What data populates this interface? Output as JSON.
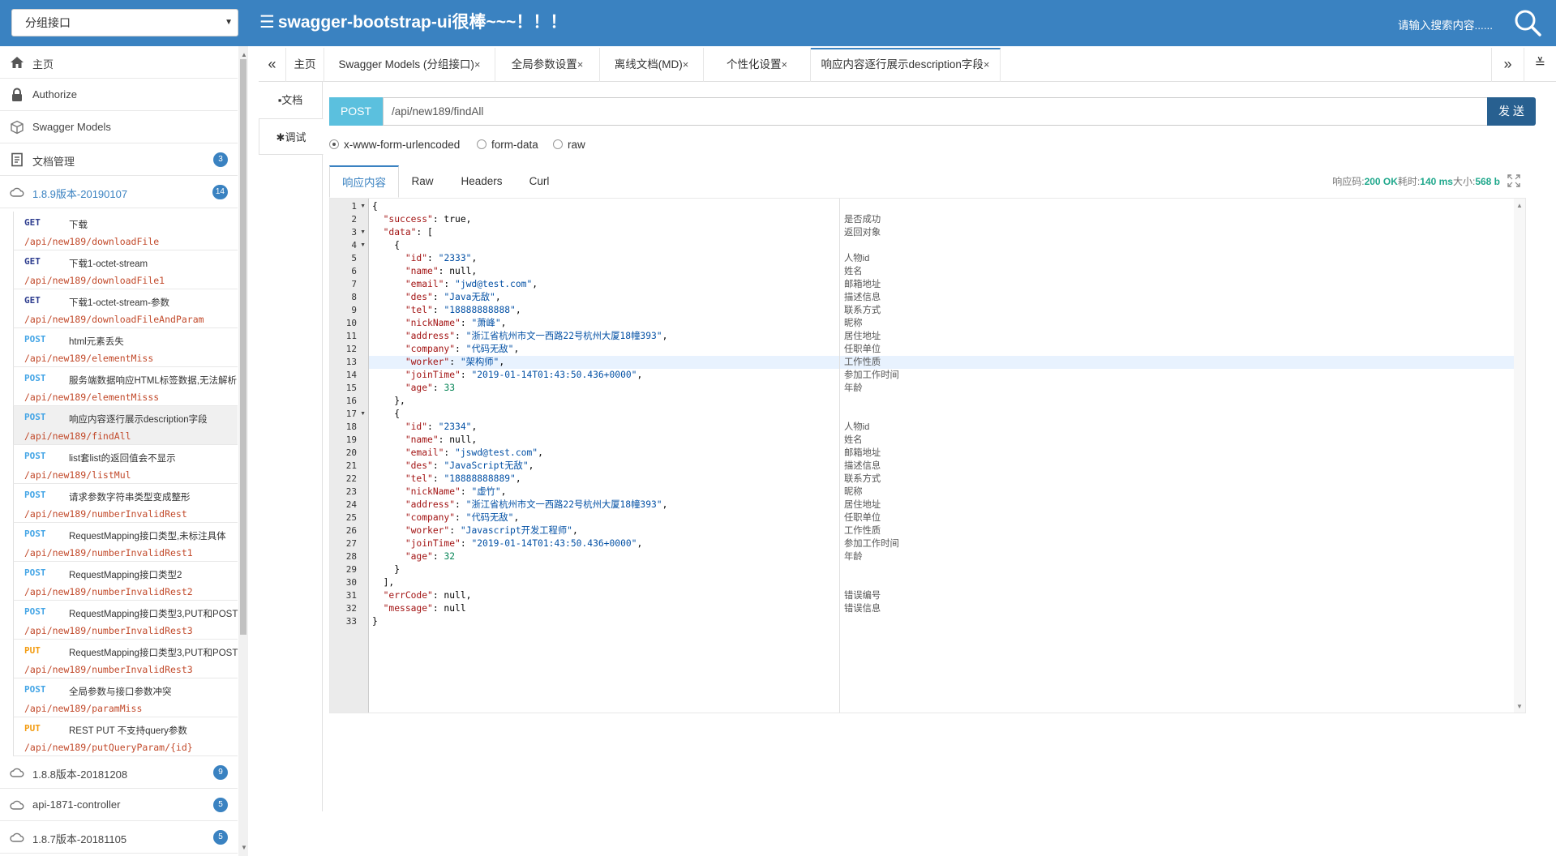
{
  "header": {
    "group_select": "分组接口",
    "menu_glyph": "☰",
    "title": "swagger-bootstrap-ui很棒~~~！！！",
    "search_placeholder": "请输入搜索内容......"
  },
  "sidebar": {
    "items": [
      {
        "label": "主页",
        "icon": "home-icon"
      },
      {
        "label": "Authorize",
        "icon": "lock-icon"
      },
      {
        "label": "Swagger Models",
        "icon": "cube-icon"
      },
      {
        "label": "文档管理",
        "icon": "document-icon",
        "badge": "3"
      },
      {
        "label": "1.8.9版本-20190107",
        "icon": "cloud-icon",
        "badge": "14"
      }
    ],
    "apis": [
      {
        "method": "GET",
        "summary": "下载",
        "path": "/api/new189/downloadFile"
      },
      {
        "method": "GET",
        "summary": "下载1-octet-stream",
        "path": "/api/new189/downloadFile1"
      },
      {
        "method": "GET",
        "summary": "下载1-octet-stream-参数",
        "path": "/api/new189/downloadFileAndParam"
      },
      {
        "method": "POST",
        "summary": "html元素丢失",
        "path": "/api/new189/elementMiss"
      },
      {
        "method": "POST",
        "summary": "服务端数据响应HTML标签数据,无法解析",
        "path": "/api/new189/elementMisss"
      },
      {
        "method": "POST",
        "summary": "响应内容逐行展示description字段",
        "path": "/api/new189/findAll"
      },
      {
        "method": "POST",
        "summary": "list套list的返回值会不显示",
        "path": "/api/new189/listMul"
      },
      {
        "method": "POST",
        "summary": "请求参数字符串类型变成整形",
        "path": "/api/new189/numberInvalidRest"
      },
      {
        "method": "POST",
        "summary": "RequestMapping接口类型,未标注具体",
        "path": "/api/new189/numberInvalidRest1"
      },
      {
        "method": "POST",
        "summary": "RequestMapping接口类型2",
        "path": "/api/new189/numberInvalidRest2"
      },
      {
        "method": "POST",
        "summary": "RequestMapping接口类型3,PUT和POST",
        "path": "/api/new189/numberInvalidRest3"
      },
      {
        "method": "PUT",
        "summary": "RequestMapping接口类型3,PUT和POST",
        "path": "/api/new189/numberInvalidRest3"
      },
      {
        "method": "POST",
        "summary": "全局参数与接口参数冲突",
        "path": "/api/new189/paramMiss"
      },
      {
        "method": "PUT",
        "summary": "REST PUT 不支持query参数",
        "path": "/api/new189/putQueryParam/{id}"
      }
    ],
    "active_api_index": 5,
    "groups": [
      {
        "label": "1.8.8版本-20181208",
        "badge": "9"
      },
      {
        "label": "api-1871-controller",
        "badge": "5"
      },
      {
        "label": "1.8.7版本-20181105",
        "badge": "5"
      }
    ]
  },
  "tabs": {
    "items": [
      {
        "label": "主页",
        "closable": false
      },
      {
        "label": "Swagger Models (分组接口)",
        "closable": true
      },
      {
        "label": "全局参数设置",
        "closable": true
      },
      {
        "label": "离线文档(MD)",
        "closable": true
      },
      {
        "label": "个性化设置",
        "closable": true
      },
      {
        "label": "响应内容逐行展示description字段",
        "closable": true
      }
    ],
    "close_glyph": "×",
    "prev_glyph": "«",
    "next_glyph": "»",
    "menu_glyph": "≚"
  },
  "side_tabs": [
    {
      "label": "文档",
      "glyph": "▪"
    },
    {
      "label": "调试",
      "glyph": "✱"
    }
  ],
  "request": {
    "method": "POST",
    "url": "/api/new189/findAll",
    "send_label": "发 送",
    "content_types": [
      "x-www-form-urlencoded",
      "form-data",
      "raw"
    ],
    "selected_content_type": 0
  },
  "response": {
    "tabs": [
      "响应内容",
      "Raw",
      "Headers",
      "Curl"
    ],
    "status_label": "响应码:",
    "status_value": "200 OK",
    "time_label": "耗时:",
    "time_value": "140 ms",
    "size_label": "大小:",
    "size_value": "568 b",
    "lines": [
      "{",
      "  \"success\": true,",
      "  \"data\": [",
      "    {",
      "      \"id\": \"2333\",",
      "      \"name\": null,",
      "      \"email\": \"jwd@test.com\",",
      "      \"des\": \"Java无敌\",",
      "      \"tel\": \"18888888888\",",
      "      \"nickName\": \"萧峰\",",
      "      \"address\": \"浙江省杭州市文一西路22号杭州大厦18幢393\",",
      "      \"company\": \"代码无敌\",",
      "      \"worker\": \"架构师\",",
      "      \"joinTime\": \"2019-01-14T01:43:50.436+0000\",",
      "      \"age\": 33",
      "    },",
      "    {",
      "      \"id\": \"2334\",",
      "      \"name\": null,",
      "      \"email\": \"jswd@test.com\",",
      "      \"des\": \"JavaScript无敌\",",
      "      \"tel\": \"18888888889\",",
      "      \"nickName\": \"虚竹\",",
      "      \"address\": \"浙江省杭州市文一西路22号杭州大厦18幢393\",",
      "      \"company\": \"代码无敌\",",
      "      \"worker\": \"Javascript开发工程师\",",
      "      \"joinTime\": \"2019-01-14T01:43:50.436+0000\",",
      "      \"age\": 32",
      "    }",
      "  ],",
      "  \"errCode\": null,",
      "  \"message\": null",
      "}"
    ],
    "descriptions": [
      "",
      "是否成功",
      "返回对象",
      "",
      "人物id",
      "姓名",
      "邮箱地址",
      "描述信息",
      "联系方式",
      "昵称",
      "居住地址",
      "任职单位",
      "工作性质",
      "参加工作时间",
      "年龄",
      "",
      "",
      "人物id",
      "姓名",
      "邮箱地址",
      "描述信息",
      "联系方式",
      "昵称",
      "居住地址",
      "任职单位",
      "工作性质",
      "参加工作时间",
      "年龄",
      "",
      "",
      "错误编号",
      "错误信息",
      ""
    ],
    "fold_lines": [
      1,
      3,
      4,
      17
    ],
    "active_line": 13
  },
  "colors": {
    "brand": "#3a82c1",
    "get": "#2d3c8e",
    "post": "#44a5e6",
    "put": "#f39c12",
    "path": "#c24a2b",
    "status_ok": "#20a88c"
  }
}
